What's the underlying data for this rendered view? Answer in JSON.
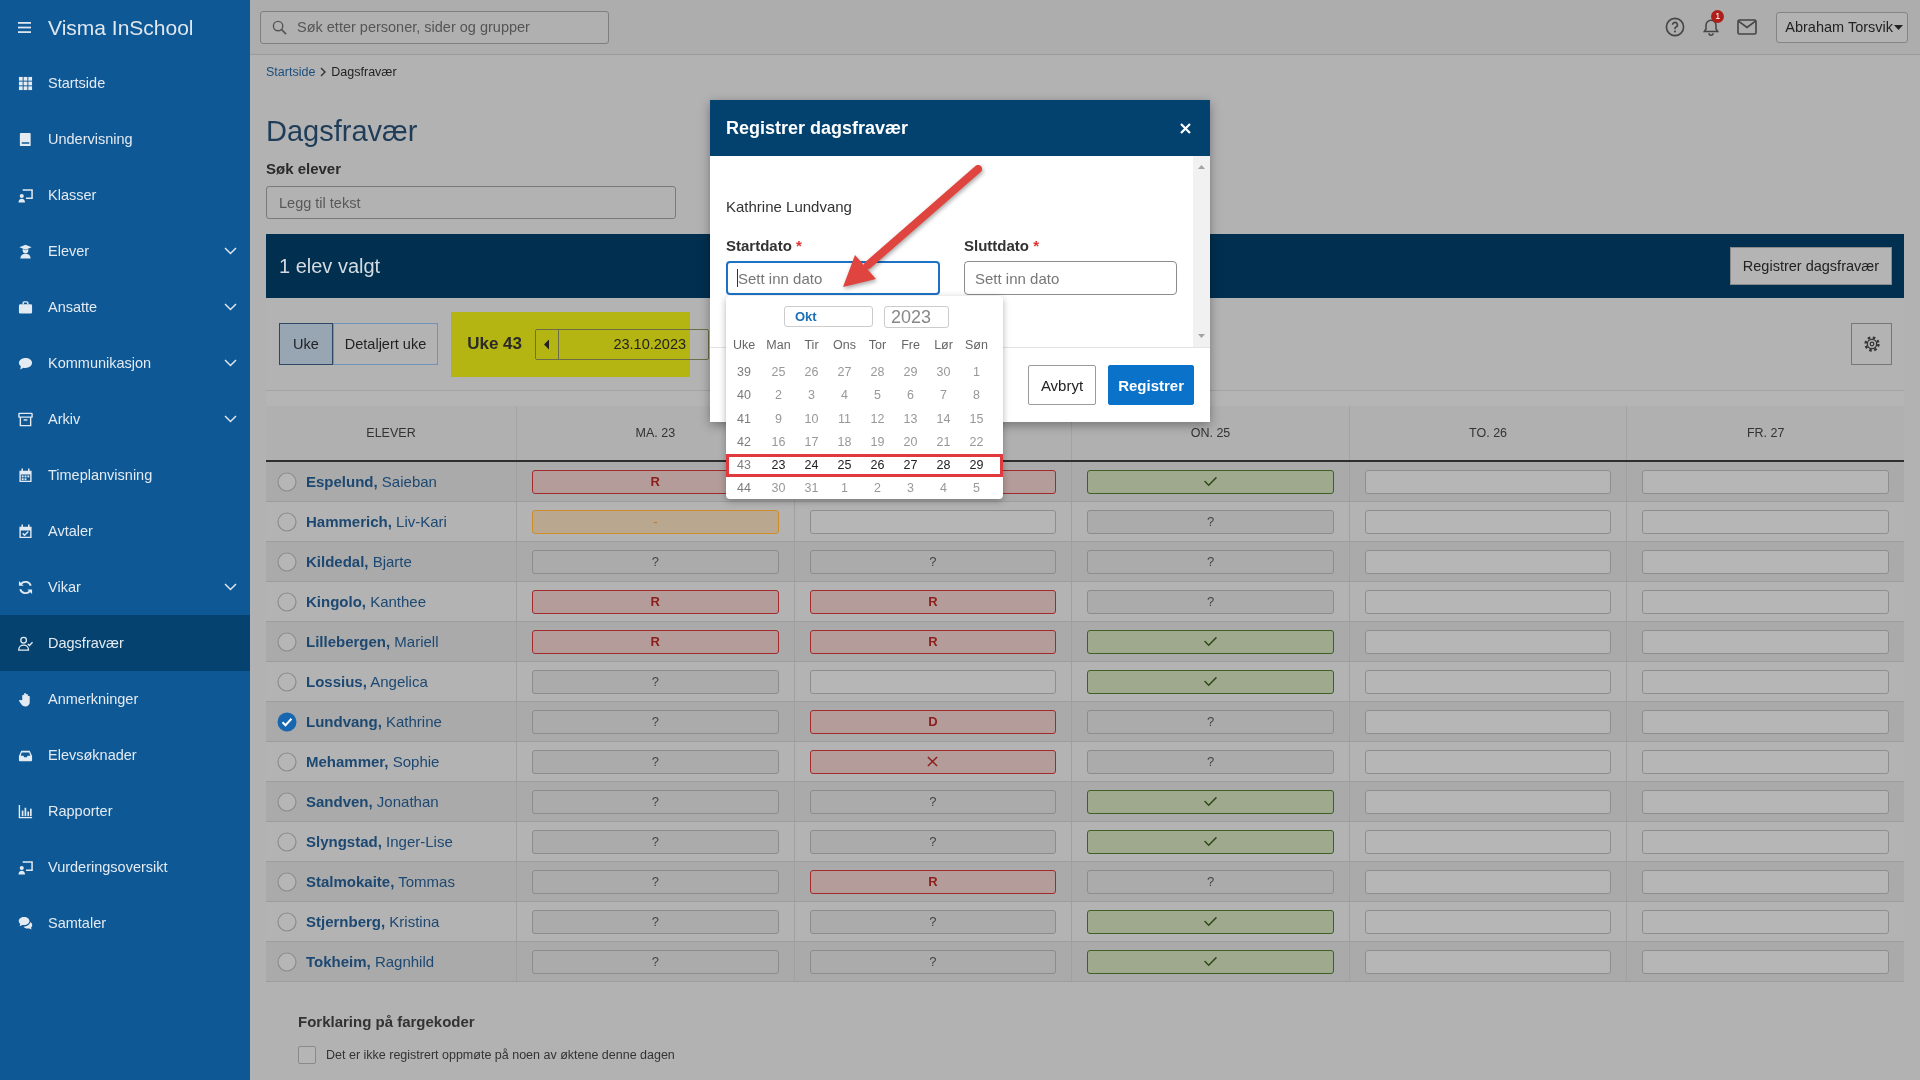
{
  "sidebar": {
    "logo": "Visma InSchool",
    "items": [
      {
        "label": "Startside",
        "submenu": false,
        "selected": false
      },
      {
        "label": "Undervisning",
        "submenu": false,
        "selected": false
      },
      {
        "label": "Klasser",
        "submenu": false,
        "selected": false
      },
      {
        "label": "Elever",
        "submenu": true,
        "selected": false
      },
      {
        "label": "Ansatte",
        "submenu": true,
        "selected": false
      },
      {
        "label": "Kommunikasjon",
        "submenu": true,
        "selected": false
      },
      {
        "label": "Arkiv",
        "submenu": true,
        "selected": false
      },
      {
        "label": "Timeplanvisning",
        "submenu": false,
        "selected": false
      },
      {
        "label": "Avtaler",
        "submenu": false,
        "selected": false
      },
      {
        "label": "Vikar",
        "submenu": true,
        "selected": false
      },
      {
        "label": "Dagsfravær",
        "submenu": false,
        "selected": true
      },
      {
        "label": "Anmerkninger",
        "submenu": false,
        "selected": false
      },
      {
        "label": "Elevsøknader",
        "submenu": false,
        "selected": false
      },
      {
        "label": "Rapporter",
        "submenu": false,
        "selected": false
      },
      {
        "label": "Vurderingsoversikt",
        "submenu": false,
        "selected": false
      },
      {
        "label": "Samtaler",
        "submenu": false,
        "selected": false
      }
    ]
  },
  "topbar": {
    "search": {
      "placeholder": "Søk etter personer, sider og grupper"
    },
    "notification_count": "1",
    "user": "Abraham Torsvik"
  },
  "breadcrumb": [
    {
      "label": "Startside",
      "link": true
    },
    {
      "label": "Dagsfravær",
      "link": false
    }
  ],
  "page_title": "Dagsfravær",
  "student_search": {
    "label": "Søk elever",
    "placeholder": "Legg til tekst"
  },
  "selection_bar": {
    "text": "1 elev valgt",
    "button": "Registrer dagsfravær"
  },
  "view_tabs": [
    {
      "label": "Uke",
      "selected": true
    },
    {
      "label": "Detaljert uke",
      "selected": false
    }
  ],
  "week_picker": {
    "label": "Uke 43",
    "date": "23.10.2023"
  },
  "table": {
    "student_column": "ELEVER",
    "day_columns": [
      {
        "label": "MA. 23"
      },
      {},
      {
        "label": "ON. 25"
      },
      {
        "label": "TO. 26"
      },
      {
        "label": "FR. 27"
      }
    ],
    "rows": [
      {
        "name": "**Espelund,** Saieban",
        "checked": false,
        "days": [
          {
            "kind": "absent",
            "text": "R"
          },
          {
            "kind": "absent"
          },
          {
            "kind": "present"
          },
          {
            "kind": "empty"
          },
          {
            "kind": "empty"
          }
        ]
      },
      {
        "name": "**Hammerich,** Liv-Kari",
        "checked": false,
        "days": [
          {
            "kind": "partial",
            "text": "-"
          },
          {
            "kind": "empty"
          },
          {
            "kind": "unregistered",
            "text": "?"
          },
          {
            "kind": "empty"
          },
          {
            "kind": "empty"
          }
        ]
      },
      {
        "name": "**Kildedal,** Bjarte",
        "checked": false,
        "days": [
          {
            "kind": "unregistered",
            "text": "?"
          },
          {
            "kind": "unregistered",
            "text": "?"
          },
          {
            "kind": "unregistered",
            "text": "?"
          },
          {
            "kind": "empty"
          },
          {
            "kind": "empty"
          }
        ]
      },
      {
        "name": "**Kingolo,** Kanthee",
        "checked": false,
        "days": [
          {
            "kind": "absent",
            "text": "R"
          },
          {
            "kind": "absent",
            "text": "R"
          },
          {
            "kind": "unregistered",
            "text": "?"
          },
          {
            "kind": "empty"
          },
          {
            "kind": "empty"
          }
        ]
      },
      {
        "name": "**Lillebergen,** Mariell",
        "checked": false,
        "days": [
          {
            "kind": "absent",
            "text": "R"
          },
          {
            "kind": "absent",
            "text": "R"
          },
          {
            "kind": "present"
          },
          {
            "kind": "empty"
          },
          {
            "kind": "empty"
          }
        ]
      },
      {
        "name": "**Lossius,** Angelica",
        "checked": false,
        "days": [
          {
            "kind": "unregistered",
            "text": "?"
          },
          {
            "kind": "empty"
          },
          {
            "kind": "present"
          },
          {
            "kind": "empty"
          },
          {
            "kind": "empty"
          }
        ]
      },
      {
        "name": "**Lundvang,** Kathrine",
        "checked": true,
        "days": [
          {
            "kind": "unregistered",
            "text": "?"
          },
          {
            "kind": "absent",
            "text": "D"
          },
          {
            "kind": "unregistered",
            "text": "?"
          },
          {
            "kind": "empty"
          },
          {
            "kind": "empty"
          }
        ]
      },
      {
        "name": "**Mehammer,** Sophie",
        "checked": false,
        "days": [
          {
            "kind": "unregistered",
            "text": "?"
          },
          {
            "kind": "crossed"
          },
          {
            "kind": "unregistered",
            "text": "?"
          },
          {
            "kind": "empty"
          },
          {
            "kind": "empty"
          }
        ]
      },
      {
        "name": "**Sandven,** Jonathan",
        "checked": false,
        "days": [
          {
            "kind": "unregistered",
            "text": "?"
          },
          {
            "kind": "unregistered",
            "text": "?"
          },
          {
            "kind": "present"
          },
          {
            "kind": "empty"
          },
          {
            "kind": "empty"
          }
        ]
      },
      {
        "name": "**Slyngstad,** Inger-Lise",
        "checked": false,
        "days": [
          {
            "kind": "unregistered",
            "text": "?"
          },
          {
            "kind": "unregistered",
            "text": "?"
          },
          {
            "kind": "present"
          },
          {
            "kind": "empty"
          },
          {
            "kind": "empty"
          }
        ]
      },
      {
        "name": "**Stalmokaite,** Tommas",
        "checked": false,
        "days": [
          {
            "kind": "unregistered",
            "text": "?"
          },
          {
            "kind": "absent",
            "text": "R"
          },
          {
            "kind": "unregistered",
            "text": "?"
          },
          {
            "kind": "empty"
          },
          {
            "kind": "empty"
          }
        ]
      },
      {
        "name": "**Stjernberg,** Kristina",
        "checked": false,
        "days": [
          {
            "kind": "unregistered",
            "text": "?"
          },
          {
            "kind": "unregistered",
            "text": "?"
          },
          {
            "kind": "present"
          },
          {
            "kind": "empty"
          },
          {
            "kind": "empty"
          }
        ]
      },
      {
        "name": "**Tokheim,** Ragnhild",
        "checked": false,
        "days": [
          {
            "kind": "unregistered",
            "text": "?"
          },
          {
            "kind": "unregistered",
            "text": "?"
          },
          {
            "kind": "present"
          },
          {
            "kind": "empty"
          },
          {
            "kind": "empty"
          }
        ]
      }
    ]
  },
  "legend": {
    "title": "Forklaring på fargekoder",
    "items": [
      "Det er ikke registrert oppmøte på noen av øktene denne dagen"
    ]
  },
  "modal": {
    "title": "Registrer dagsfravær",
    "student": "Kathrine Lundvang",
    "fields": [
      {
        "label": "Startdato",
        "required_mark": "*",
        "placeholder": "Sett inn dato",
        "focused": true
      },
      {
        "label": "Sluttdato",
        "required_mark": "*",
        "placeholder": "Sett inn dato",
        "focused": false
      }
    ],
    "datepicker": {
      "month": "Okt",
      "year": "2023",
      "headers": [
        "Uke",
        "Man",
        "Tir",
        "Ons",
        "Tor",
        "Fre",
        "Lør",
        "Søn"
      ],
      "weeks": [
        {
          "number": "39",
          "days": [
            "25",
            "26",
            "27",
            "28",
            "29",
            "30",
            "1"
          ],
          "disabled": true,
          "highlighted": false
        },
        {
          "number": "40",
          "days": [
            "2",
            "3",
            "4",
            "5",
            "6",
            "7",
            "8"
          ],
          "disabled": true,
          "highlighted": false
        },
        {
          "number": "41",
          "days": [
            "9",
            "10",
            "11",
            "12",
            "13",
            "14",
            "15"
          ],
          "disabled": true,
          "highlighted": false
        },
        {
          "number": "42",
          "days": [
            "16",
            "17",
            "18",
            "19",
            "20",
            "21",
            "22"
          ],
          "disabled": true,
          "highlighted": false
        },
        {
          "number": "43",
          "days": [
            "23",
            "24",
            "25",
            "26",
            "27",
            "28",
            "29"
          ],
          "disabled": false,
          "highlighted": true
        },
        {
          "number": "44",
          "days": [
            "30",
            "31",
            "1",
            "2",
            "3",
            "4",
            "5"
          ],
          "disabled": true,
          "highlighted": false
        }
      ]
    },
    "buttons": [
      {
        "label": "Avbryt",
        "kind": "secondary"
      },
      {
        "label": "Registrer",
        "kind": "primary"
      }
    ]
  }
}
